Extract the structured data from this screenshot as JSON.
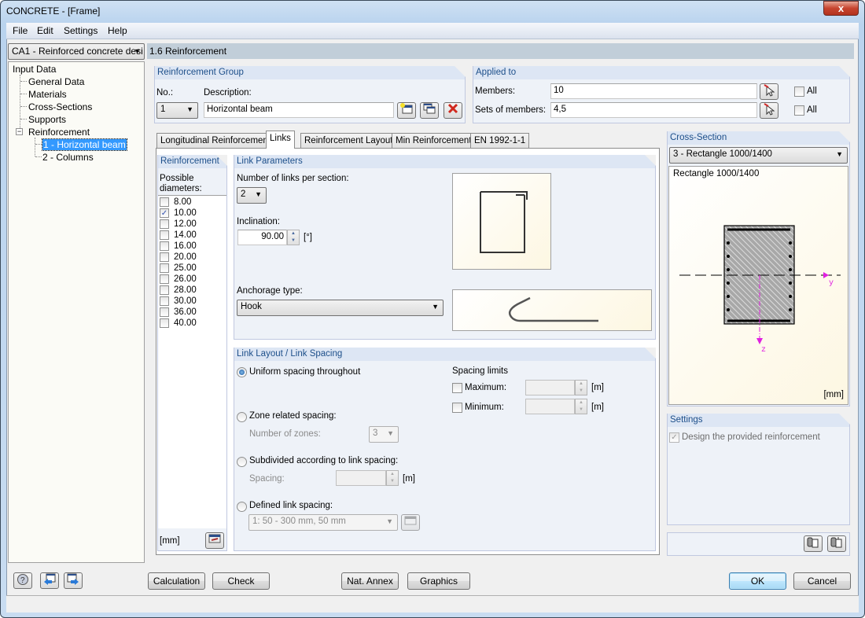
{
  "window": {
    "title": "CONCRETE - [Frame]",
    "close_label": "x"
  },
  "menu": [
    "File",
    "Edit",
    "Settings",
    "Help"
  ],
  "case_selector": {
    "value": "CA1 - Reinforced concrete desi"
  },
  "tree": {
    "root": "Input Data",
    "items": [
      "General Data",
      "Materials",
      "Cross-Sections",
      "Supports",
      "Reinforcement"
    ],
    "children": [
      "1 - Horizontal beam",
      "2 - Columns"
    ],
    "selected": "1 - Horizontal beam"
  },
  "header": {
    "title": "1.6 Reinforcement"
  },
  "reinforcement_group": {
    "title": "Reinforcement Group",
    "no_label": "No.:",
    "no_value": "1",
    "description_label": "Description:",
    "description_value": "Horizontal beam"
  },
  "applied_to": {
    "title": "Applied to",
    "members_label": "Members:",
    "members_value": "10",
    "sets_label": "Sets of members:",
    "sets_value": "4,5",
    "all_label": "All",
    "members_all": false,
    "sets_all": false
  },
  "tabs": [
    {
      "label": "Longitudinal Reinforcement",
      "active": false
    },
    {
      "label": "Links",
      "active": true
    },
    {
      "label": "Reinforcement Layout",
      "active": false
    },
    {
      "label": "Min Reinforcement",
      "active": false
    },
    {
      "label": "EN 1992-1-1",
      "active": false
    }
  ],
  "reinforcement": {
    "title": "Reinforcement",
    "possible_label": "Possible",
    "diameters_label": "diameters:",
    "diameters": [
      {
        "value": "8.00",
        "checked": false
      },
      {
        "value": "10.00",
        "checked": true
      },
      {
        "value": "12.00",
        "checked": false
      },
      {
        "value": "14.00",
        "checked": false
      },
      {
        "value": "16.00",
        "checked": false
      },
      {
        "value": "20.00",
        "checked": false
      },
      {
        "value": "25.00",
        "checked": false
      },
      {
        "value": "26.00",
        "checked": false
      },
      {
        "value": "28.00",
        "checked": false
      },
      {
        "value": "30.00",
        "checked": false
      },
      {
        "value": "36.00",
        "checked": false
      },
      {
        "value": "40.00",
        "checked": false
      }
    ],
    "unit": "[mm]"
  },
  "link_parameters": {
    "title": "Link Parameters",
    "links_label": "Number of links per section:",
    "links_value": "2",
    "inclination_label": "Inclination:",
    "inclination_value": "90.00",
    "inclination_unit": "[°]",
    "anchorage_label": "Anchorage type:",
    "anchorage_value": "Hook"
  },
  "link_layout": {
    "title": "Link Layout / Link Spacing",
    "uniform_label": "Uniform spacing throughout",
    "zone_label": "Zone related spacing:",
    "zones_label": "Number of zones:",
    "zones_value": "3",
    "subdivided_label": "Subdivided according to link spacing:",
    "spacing_label": "Spacing:",
    "spacing_unit": "[m]",
    "defined_label": "Defined link spacing:",
    "defined_value": "1: 50 - 300 mm, 50 mm",
    "selected": "uniform",
    "limits_title": "Spacing limits",
    "maximum_label": "Maximum:",
    "minimum_label": "Minimum:",
    "limit_unit": "[m]"
  },
  "cross_section": {
    "title": "Cross-Section",
    "value": "3 - Rectangle 1000/1400",
    "caption": "Rectangle 1000/1400",
    "unit": "[mm]",
    "axis_y": "y",
    "axis_z": "z"
  },
  "settings": {
    "title": "Settings",
    "design_label": "Design the provided reinforcement",
    "design_checked": true
  },
  "buttons": {
    "calculation": "Calculation",
    "check": "Check",
    "nat_annex": "Nat. Annex ...",
    "graphics": "Graphics",
    "ok": "OK",
    "cancel": "Cancel"
  }
}
